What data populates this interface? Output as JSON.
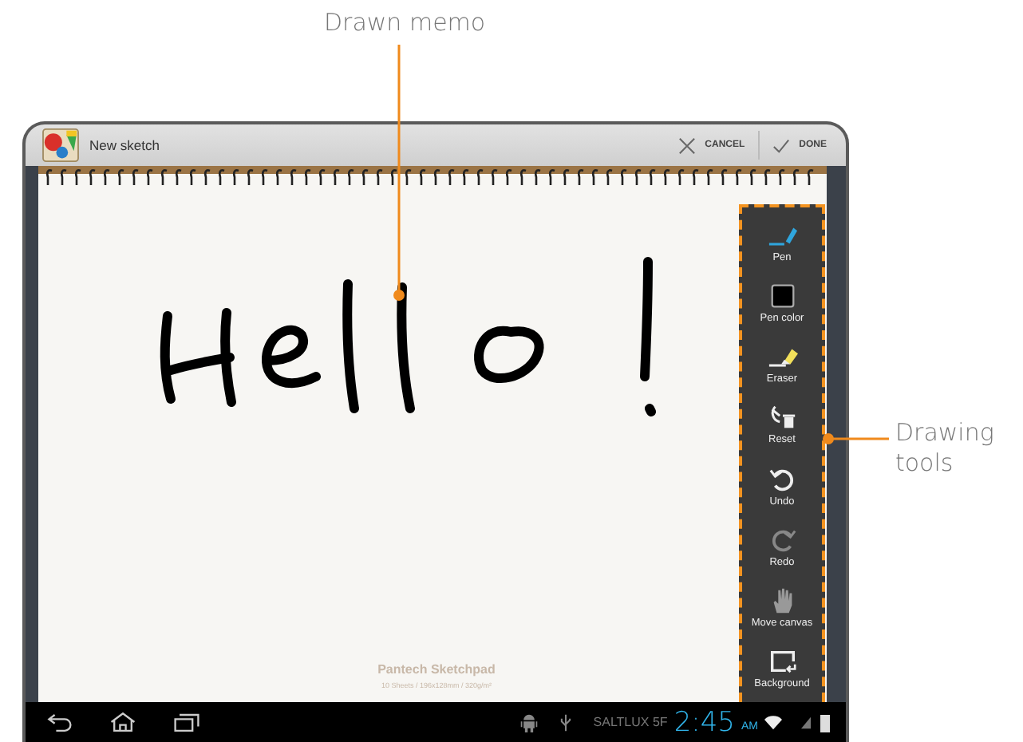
{
  "callouts": [
    {
      "label": "Drawn memo"
    },
    {
      "label": "Drawing tools"
    }
  ],
  "app_bar": {
    "title": "New sketch",
    "actions": [
      {
        "kind": "cancel",
        "label": "CANCEL"
      },
      {
        "kind": "done",
        "label": "DONE"
      }
    ]
  },
  "canvas": {
    "pad_title": "Pantech Sketchpad",
    "pad_subtitle": "10 Sheets / 196x128mm / 320g/m²"
  },
  "tools": [
    {
      "kind": "pen",
      "label": "Pen",
      "selected": true
    },
    {
      "kind": "color",
      "label": "Pen color",
      "selected": false
    },
    {
      "kind": "eraser",
      "label": "Eraser",
      "selected": false
    },
    {
      "kind": "reset",
      "label": "Reset",
      "selected": false
    },
    {
      "kind": "undo",
      "label": "Undo",
      "selected": false
    },
    {
      "kind": "redo",
      "label": "Redo",
      "selected": false
    },
    {
      "kind": "move",
      "label": "Move canvas",
      "selected": false
    },
    {
      "kind": "background",
      "label": "Background",
      "selected": false
    }
  ],
  "status_bar": {
    "network": "SALTLUX 5F",
    "time": "2:45",
    "ampm": "AM"
  }
}
